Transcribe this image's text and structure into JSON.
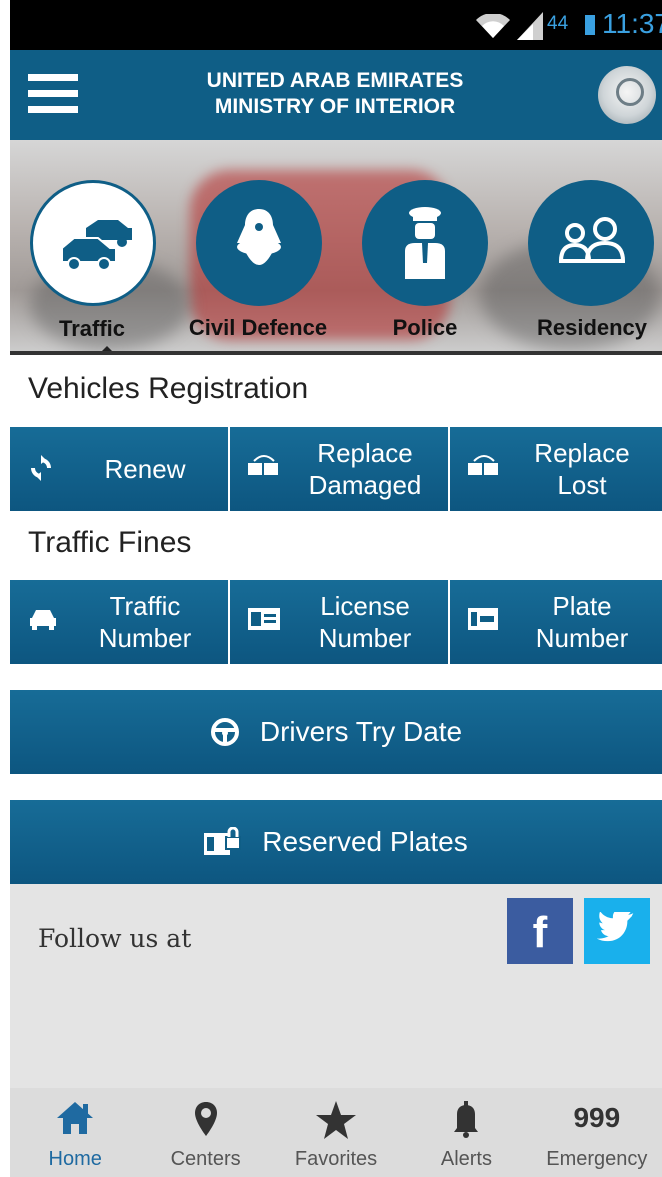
{
  "status_bar": {
    "battery_level": "44",
    "time": "11:37",
    "icons": [
      "wifi-icon",
      "signal-icon",
      "battery-icon"
    ]
  },
  "header": {
    "title_line1": "UNITED ARAB EMIRATES",
    "title_line2": "MINISTRY OF INTERIOR",
    "menu_icon": "hamburger-menu-icon",
    "logo": "ministry-emblem"
  },
  "categories": [
    {
      "label": "Traffic",
      "icon": "cars-icon",
      "active": true
    },
    {
      "label": "Civil Defence",
      "icon": "firefighter-icon",
      "active": false
    },
    {
      "label": "Police",
      "icon": "police-officer-icon",
      "active": false
    },
    {
      "label": "Residency",
      "icon": "people-group-icon",
      "active": false
    }
  ],
  "vehicles_registration": {
    "title": "Vehicles Registration",
    "buttons": [
      {
        "line1": "Renew",
        "line2": "",
        "icon": "renew-icon"
      },
      {
        "line1": "Replace",
        "line2": "Damaged",
        "icon": "replace-card-icon"
      },
      {
        "line1": "Replace",
        "line2": "Lost",
        "icon": "replace-card-icon"
      }
    ]
  },
  "traffic_fines": {
    "title": "Traffic Fines",
    "buttons": [
      {
        "line1": "Traffic",
        "line2": "Number",
        "icon": "car-front-icon"
      },
      {
        "line1": "License",
        "line2": "Number",
        "icon": "license-card-icon"
      },
      {
        "line1": "Plate",
        "line2": "Number",
        "icon": "plate-icon"
      }
    ]
  },
  "drivers_try_date": {
    "label": "Drivers Try Date",
    "icon": "steering-wheel-icon"
  },
  "reserved_plates": {
    "label": "Reserved Plates",
    "icon": "locked-plate-icon"
  },
  "follow": {
    "label": "Follow us at",
    "facebook_glyph": "f",
    "icons": [
      "facebook-icon",
      "twitter-icon"
    ]
  },
  "bottom_nav": [
    {
      "label": "Home",
      "icon": "home-icon",
      "active": true
    },
    {
      "label": "Centers",
      "icon": "location-pin-icon",
      "active": false
    },
    {
      "label": "Favorites",
      "icon": "star-icon",
      "active": false
    },
    {
      "label": "Alerts",
      "icon": "bell-icon",
      "active": false
    },
    {
      "label": "Emergency",
      "number": "999",
      "active": false
    }
  ],
  "colors": {
    "primary": "#0f5e86",
    "status_text": "#3aa0e0",
    "facebook": "#3b5ca0",
    "twitter": "#19b0ec",
    "nav_active": "#1f6aa1"
  }
}
